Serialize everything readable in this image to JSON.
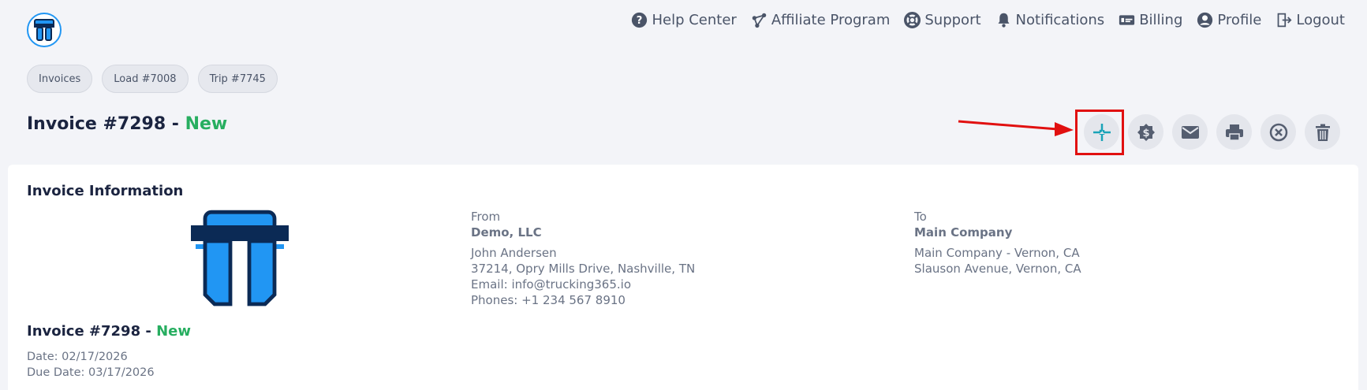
{
  "topnav": [
    {
      "label": "Help Center",
      "icon": "help-circle-icon"
    },
    {
      "label": "Affiliate Program",
      "icon": "affiliate-icon"
    },
    {
      "label": "Support",
      "icon": "lifebuoy-icon"
    },
    {
      "label": "Notifications",
      "icon": "bell-icon"
    },
    {
      "label": "Billing",
      "icon": "billing-card-icon"
    },
    {
      "label": "Profile",
      "icon": "user-circle-icon"
    },
    {
      "label": "Logout",
      "icon": "logout-icon"
    }
  ],
  "breadcrumbs": [
    "Invoices",
    "Load #7008",
    "Trip #7745"
  ],
  "header": {
    "title": "Invoice #7298 - ",
    "status": "New"
  },
  "actions": [
    "compress-icon",
    "dollar-badge-icon",
    "envelope-icon",
    "printer-icon",
    "cancel-circle-icon",
    "trash-icon"
  ],
  "invoice": {
    "section_title": "Invoice Information",
    "from": {
      "label": "From",
      "company": "Demo, LLC",
      "lines": [
        "John Andersen",
        "37214, Opry Mills Drive, Nashville, TN",
        "Email: info@trucking365.io",
        "Phones: +1 234 567 8910"
      ]
    },
    "to": {
      "label": "To",
      "company": "Main Company",
      "lines": [
        "Main Company - Vernon, CA",
        "Slauson Avenue, Vernon, CA"
      ]
    },
    "title": "Invoice #7298 - ",
    "status": "New",
    "date": "Date: 02/17/2026",
    "due_date": "Due Date: 03/17/2026"
  },
  "colors": {
    "accent": "#2196f3",
    "status_new": "#27ae60",
    "highlight": "#e11010",
    "teal": "#1aa3b8"
  }
}
